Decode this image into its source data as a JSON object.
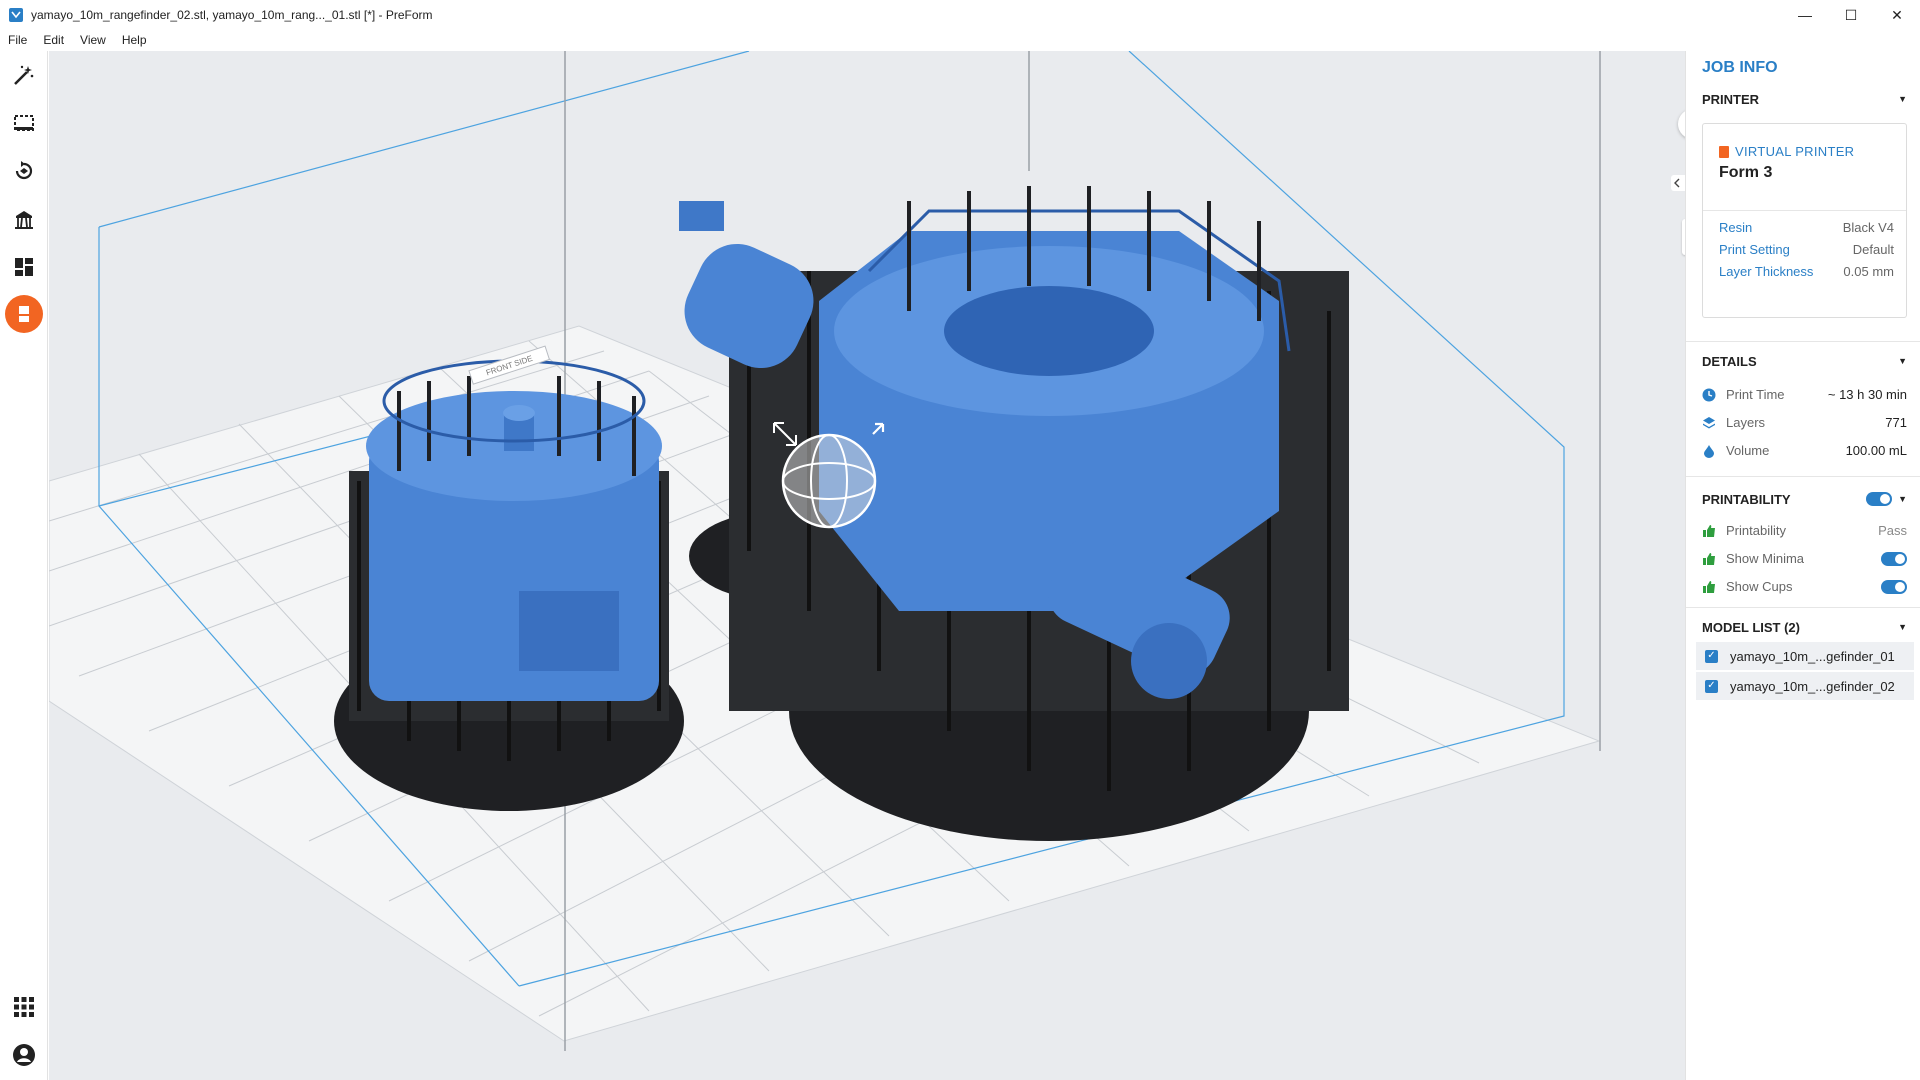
{
  "window": {
    "title": "yamayo_10m_rangefinder_02.stl, yamayo_10m_rang..._01.stl [*] - PreForm",
    "minimize": "—",
    "maximize": "☐",
    "close": "✕"
  },
  "menu": [
    "File",
    "Edit",
    "View",
    "Help"
  ],
  "toolbar": {
    "tools": [
      "magic-wand-icon",
      "select-box-icon",
      "orientation-icon",
      "supports-icon",
      "layout-icon",
      "job-info-icon"
    ],
    "bottom": [
      "apps-grid-icon",
      "account-icon"
    ]
  },
  "viewport": {
    "collapse_glyph": "›",
    "zoom_in": "+",
    "zoom_out": "−",
    "plate_label": "FRONT SIDE"
  },
  "panel": {
    "title": "JOB INFO",
    "printer": {
      "heading": "PRINTER",
      "virtual_label": "VIRTUAL PRINTER",
      "model": "Form 3",
      "props": [
        {
          "k": "Resin",
          "v": "Black V4"
        },
        {
          "k": "Print Setting",
          "v": "Default"
        },
        {
          "k": "Layer Thickness",
          "v": "0.05 mm"
        }
      ]
    },
    "details": {
      "heading": "DETAILS",
      "rows": [
        {
          "k": "Print Time",
          "v": "~ 13 h 30 min",
          "icon": "clock-icon"
        },
        {
          "k": "Layers",
          "v": "771",
          "icon": "layers-icon"
        },
        {
          "k": "Volume",
          "v": "100.00 mL",
          "icon": "resin-drop-icon"
        }
      ]
    },
    "printability": {
      "heading": "PRINTABILITY",
      "rows": [
        {
          "k": "Printability",
          "v": "Pass"
        },
        {
          "k": "Show Minima",
          "v": ""
        },
        {
          "k": "Show Cups",
          "v": ""
        }
      ]
    },
    "model_list": {
      "heading": "MODEL LIST (2)",
      "items": [
        "yamayo_10m_...gefinder_01",
        "yamayo_10m_...gefinder_02"
      ]
    }
  },
  "colors": {
    "accent": "#2a7fc6",
    "model_blue": "#4a84d4",
    "support_black": "#2b2d30",
    "active_tool": "#f26522"
  }
}
